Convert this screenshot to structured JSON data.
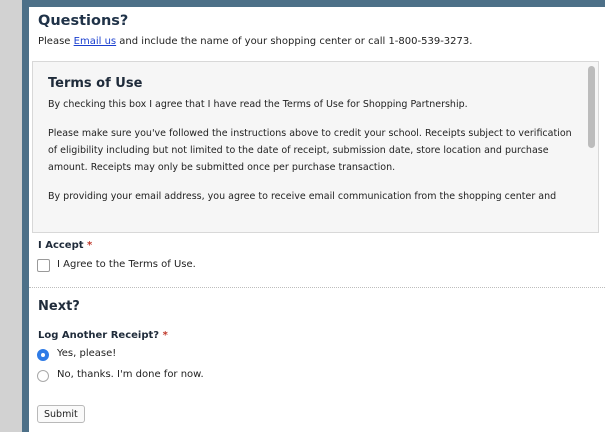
{
  "questions": {
    "title": "Questions?",
    "text_before": "Please ",
    "link_text": "Email us",
    "text_after": " and include the name of your shopping center or call 1-800-539-3273."
  },
  "terms": {
    "title": "Terms of Use",
    "p1": "By checking this box I agree that I have read the Terms of Use for Shopping Partnership.",
    "p2": "Please make sure you've followed the instructions above to credit your school. Receipts subject to verification of eligibility including but not limited to the date of receipt, submission date, store location and purchase amount. Receipts may only be submitted once per purchase transaction.",
    "p3": "By providing your email address, you agree to receive email communication from the shopping center and"
  },
  "accept": {
    "label": "I Accept",
    "required_mark": "*",
    "checkbox_label": "I Agree to the Terms of Use."
  },
  "next": {
    "title": "Next?",
    "question_label": "Log Another Receipt?",
    "required_mark": "*",
    "options": [
      {
        "label": "Yes, please!",
        "selected": true
      },
      {
        "label": "No, thanks. I'm done for now.",
        "selected": false
      }
    ]
  },
  "submit_label": "Submit",
  "colors": {
    "frame": "#4d7088",
    "radio_selected": "#2f7be6",
    "link": "#1a3fcf",
    "required": "#c0392b"
  }
}
